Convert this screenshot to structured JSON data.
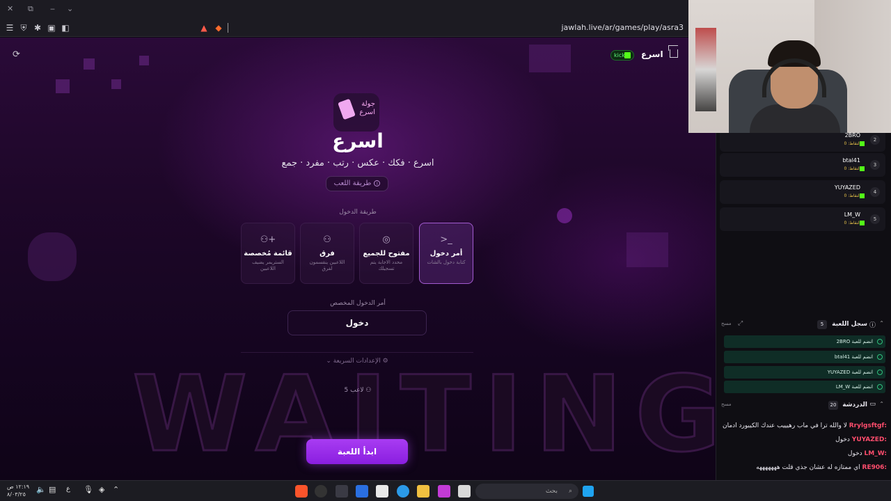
{
  "browser": {
    "url": "jawlah.live/ar/games/play/asra3"
  },
  "header": {
    "game_name": "اسرع",
    "kick_label": "kick"
  },
  "game": {
    "logo_text_1": "جولة",
    "logo_text_2": "اسرع",
    "title": "اسرع",
    "subtitle": "اسرع · فكك · عكس · رتب · مفرد · جمع",
    "howto_label": "طريقة اللعب",
    "entry_method_label": "طريقة الدخول",
    "modes": [
      {
        "icon": "terminal-icon",
        "title": "أمر دخول",
        "desc": "كتابة دخول بالشات",
        "selected": true
      },
      {
        "icon": "globe-icon",
        "title": "مفتوح للجميع",
        "desc": "محدد الاجابة يتم تسجيلك",
        "selected": false
      },
      {
        "icon": "users-icon",
        "title": "فرق",
        "desc": "اللاعبين ينقسمون لفرق",
        "selected": false
      },
      {
        "icon": "user-plus-icon",
        "title": "قائمة مُخصصة",
        "desc": "الستريمر يضيف اللاعبين",
        "selected": false
      }
    ],
    "custom_command_label": "أمر الدخول المخصص",
    "custom_command_value": "دخول",
    "quick_settings_label": "الإعدادات السريعة",
    "players_count_label": "5 لاعب",
    "start_button": "ابدأ اللعبة",
    "background_word": "WAITING"
  },
  "players": [
    {
      "name": "2BRO",
      "points": "النقاط: 0",
      "rank": "2"
    },
    {
      "name": "btal41",
      "points": "النقاط: 0",
      "rank": "3"
    },
    {
      "name": "YUYAZED",
      "points": "النقاط: 0",
      "rank": "4"
    },
    {
      "name": "LM_W",
      "points": "النقاط: 0",
      "rank": "5"
    }
  ],
  "game_log": {
    "title": "سجل اللعبة",
    "count": "5",
    "clear": "مسح",
    "entries": [
      "2BRO انضم للعبة",
      "btal41 انضم للعبة",
      "YUYAZED انضم للعبة",
      "LM_W انضم للعبة"
    ]
  },
  "chat": {
    "title": "الدردشة",
    "count": "20",
    "clear": "مسح",
    "messages": [
      {
        "user": "Rrylgsftgf:",
        "text": "لا والله ترا في ماب رهيييب عندك الكيبورد ادمان"
      },
      {
        "user": "YUYAZED:",
        "text": "دخول"
      },
      {
        "user": "LM_W:",
        "text": "دخول"
      },
      {
        "user": "RE906:",
        "text": "اي ممتازه له عشان جذي قلت هههههههه"
      }
    ]
  },
  "taskbar": {
    "search_placeholder": "بحث",
    "time": "١٢:١٩ ص",
    "date": "٨/٠٣/٢٥"
  },
  "colors": {
    "accent": "#9a2ee8",
    "kick_green": "#53fc18"
  }
}
